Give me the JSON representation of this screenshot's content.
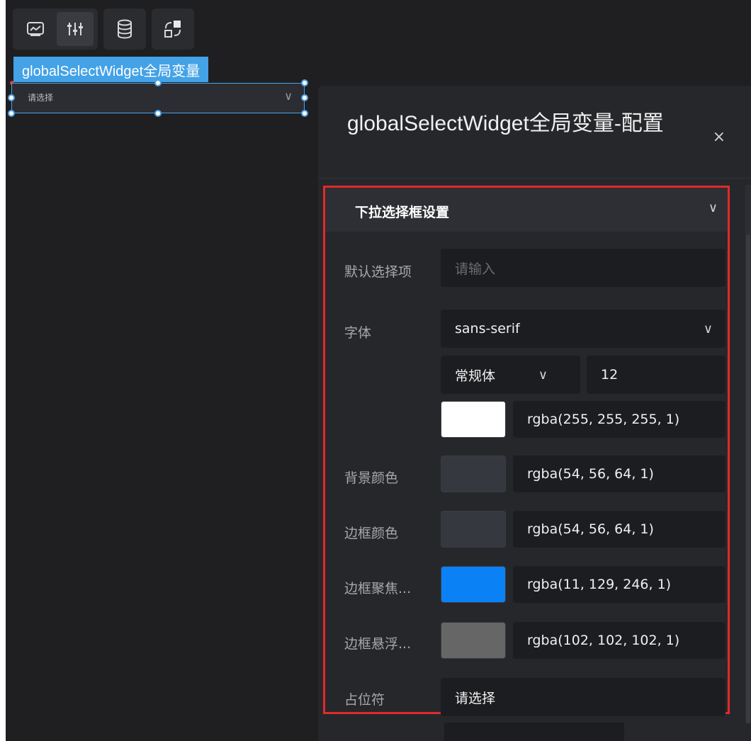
{
  "widget": {
    "tag_label": "globalSelectWidget全局变量",
    "placeholder": "请选择"
  },
  "panel": {
    "title": "globalSelectWidget全局变量-配置",
    "close_label": "×",
    "section_title": "下拉选择框设置",
    "default_option": {
      "label": "默认选择项",
      "placeholder": "请输入"
    },
    "font": {
      "label": "字体",
      "family": "sans-serif",
      "weight": "常规体",
      "size": "12",
      "color_value": "rgba(255, 255, 255, 1)",
      "color_hex": "#ffffff"
    },
    "bg_color": {
      "label": "背景颜色",
      "value": "rgba(54, 56, 64, 1)",
      "hex": "#363840"
    },
    "border_color": {
      "label": "边框颜色",
      "value": "rgba(54, 56, 64, 1)",
      "hex": "#363840"
    },
    "border_focus": {
      "label": "边框聚焦...",
      "value": "rgba(11, 129, 246, 1)",
      "hex": "#0b81f6"
    },
    "border_hover": {
      "label": "边框悬浮...",
      "value": "rgba(102, 102, 102, 1)",
      "hex": "#666666"
    },
    "placeholder_row": {
      "label": "占位符",
      "value": "请选择"
    }
  },
  "icons": [
    "image-icon",
    "sliders-icon",
    "database-icon",
    "swap-icon",
    "chevron-down-icon",
    "close-icon"
  ]
}
